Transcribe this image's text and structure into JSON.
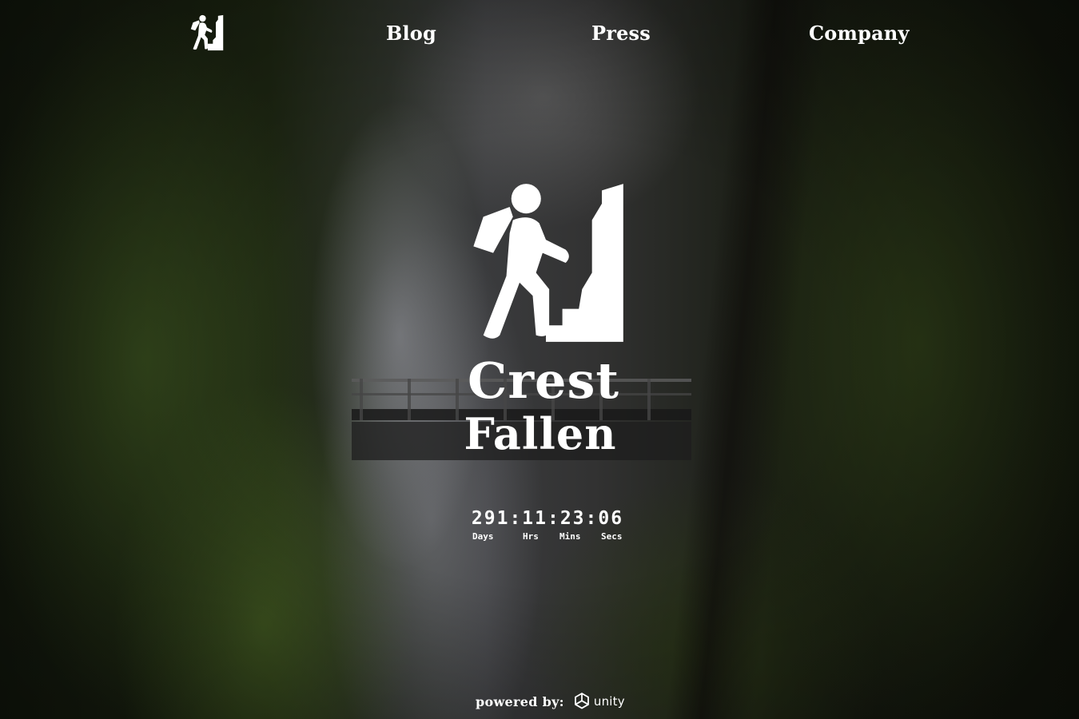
{
  "nav": {
    "logo_icon": "climber-icon",
    "links": [
      {
        "label": "Blog"
      },
      {
        "label": "Press"
      },
      {
        "label": "Company"
      }
    ]
  },
  "hero": {
    "icon": "climber-icon",
    "title_line1": "Crest",
    "title_line2": "Fallen"
  },
  "countdown": {
    "value": "291:11:23:06",
    "labels": {
      "days": "Days",
      "hrs": "Hrs",
      "mins": "Mins",
      "secs": "Secs"
    }
  },
  "footer": {
    "powered_by": "powered by:",
    "engine_icon": "unity-icon",
    "engine_name": "unity"
  },
  "colors": {
    "text": "#ffffff",
    "background": "#141a0e"
  }
}
